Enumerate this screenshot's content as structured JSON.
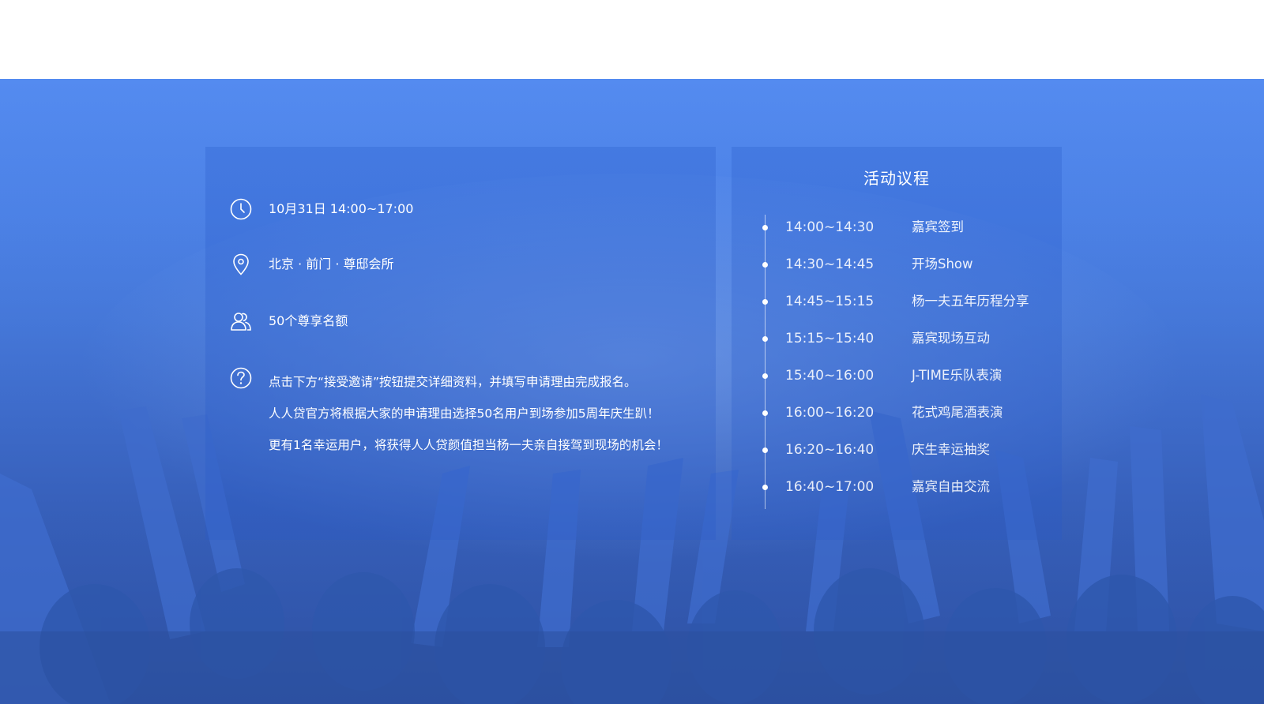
{
  "info": {
    "datetime": "10月31日 14:00~17:00",
    "location": "北京 ·  前门 · 尊邸会所",
    "quota": "50个尊享名额",
    "description": [
      "点击下方“接受邀请”按钮提交详细资料，并填写申请理由完成报名。",
      "人人贷官方将根据大家的申请理由选择50名用户到场参加5周年庆生趴！",
      "更有1名幸运用户，将获得人人贷颜值担当杨一夫亲自接驾到现场的机会！"
    ]
  },
  "agenda": {
    "title": "活动议程",
    "items": [
      {
        "time": "14:00~14:30",
        "event": "嘉宾签到"
      },
      {
        "time": "14:30~14:45",
        "event": "开场Show"
      },
      {
        "time": "14:45~15:15",
        "event": "杨一夫五年历程分享"
      },
      {
        "time": "15:15~15:40",
        "event": "嘉宾现场互动"
      },
      {
        "time": "15:40~16:00",
        "event": "J-TIME乐队表演"
      },
      {
        "time": "16:00~16:20",
        "event": "花式鸡尾酒表演"
      },
      {
        "time": "16:20~16:40",
        "event": "庆生幸运抽奖"
      },
      {
        "time": "16:40~17:00",
        "event": "嘉宾自由交流"
      }
    ]
  },
  "icons": {
    "datetime": "clock-icon",
    "location": "location-pin-icon",
    "quota": "users-icon",
    "description": "question-icon"
  },
  "colors": {
    "top_band": "#ffffff",
    "hero_blue": "#548bf0",
    "deep_blue": "#3258ad",
    "text": "#ffffff"
  }
}
